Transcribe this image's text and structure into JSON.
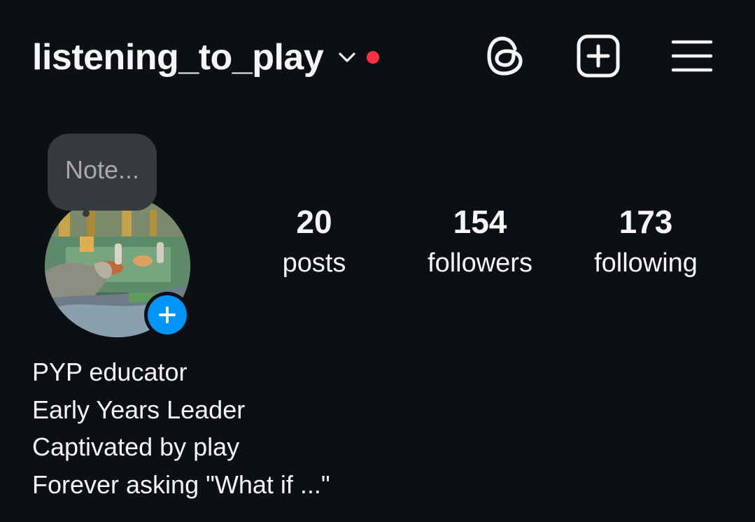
{
  "header": {
    "username": "listening_to_play",
    "switcher_icon": "chevron-down-icon",
    "notification_color": "#ff3040",
    "actions": [
      {
        "name": "threads",
        "icon": "threads-icon"
      },
      {
        "name": "create",
        "icon": "plus-square-icon"
      },
      {
        "name": "menu",
        "icon": "hamburger-menu-icon"
      }
    ]
  },
  "profile": {
    "note_placeholder": "Note...",
    "add_story_icon": "plus-icon",
    "add_story_color": "#0095f6",
    "stats": {
      "posts": {
        "count": "20",
        "label": "posts"
      },
      "followers": {
        "count": "154",
        "label": "followers"
      },
      "following": {
        "count": "173",
        "label": "following"
      }
    },
    "bio": [
      "PYP educator",
      "Early Years Leader",
      "Captivated by play",
      "Forever asking \"What if ...\""
    ]
  },
  "colors": {
    "background": "#0c1014",
    "text": "#f5f5f5",
    "bubble": "#363a3f",
    "muted": "#a8a8ad"
  }
}
